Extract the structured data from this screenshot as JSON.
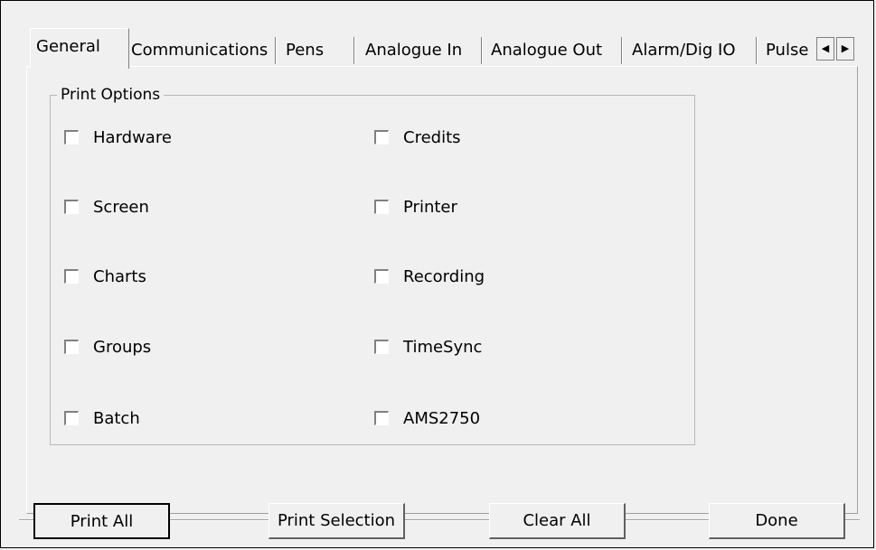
{
  "tabs": [
    {
      "label": "General",
      "active": true
    },
    {
      "label": "Communications",
      "active": false
    },
    {
      "label": "Pens",
      "active": false
    },
    {
      "label": "Analogue In",
      "active": false
    },
    {
      "label": "Analogue Out",
      "active": false
    },
    {
      "label": "Alarm/Dig IO",
      "active": false
    },
    {
      "label": "Pulse",
      "active": false
    }
  ],
  "tab_scroll": {
    "left_icon": "arrow-left-icon",
    "right_icon": "arrow-right-icon"
  },
  "print_options": {
    "title": "Print Options",
    "left_column": [
      {
        "label": "Hardware",
        "checked": false
      },
      {
        "label": "Screen",
        "checked": false
      },
      {
        "label": "Charts",
        "checked": false
      },
      {
        "label": "Groups",
        "checked": false
      },
      {
        "label": "Batch",
        "checked": false
      }
    ],
    "right_column": [
      {
        "label": "Credits",
        "checked": false
      },
      {
        "label": "Printer",
        "checked": false
      },
      {
        "label": "Recording",
        "checked": false
      },
      {
        "label": "TimeSync",
        "checked": false
      },
      {
        "label": "AMS2750",
        "checked": false
      }
    ]
  },
  "buttons": {
    "print_all": "Print All",
    "print_selection": "Print Selection",
    "clear_all": "Clear All",
    "done": "Done"
  }
}
